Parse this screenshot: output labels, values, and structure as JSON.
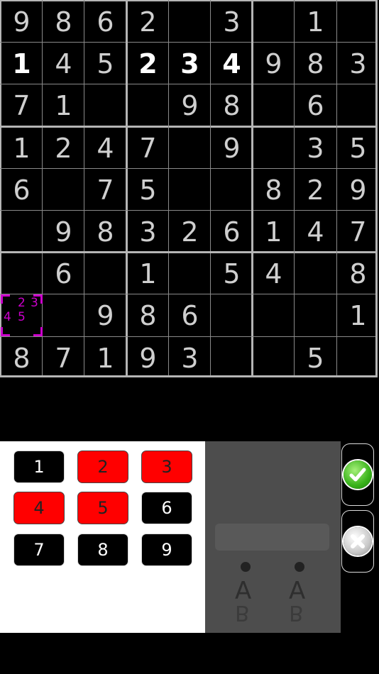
{
  "board": {
    "rows": [
      [
        "9",
        "8",
        "6",
        "2",
        "",
        "3",
        "",
        "1",
        ""
      ],
      [
        "1",
        "4",
        "5",
        "2",
        "3",
        "4",
        "9",
        "8",
        "3"
      ],
      [
        "7",
        "1",
        "",
        "",
        "9",
        "8",
        "",
        "6",
        ""
      ],
      [
        "1",
        "2",
        "4",
        "7",
        "",
        "9",
        "",
        "3",
        "5"
      ],
      [
        "6",
        "",
        "7",
        "5",
        "",
        "",
        "8",
        "2",
        "9"
      ],
      [
        "",
        "9",
        "8",
        "3",
        "2",
        "6",
        "1",
        "4",
        "7"
      ],
      [
        "",
        "6",
        "",
        "1",
        "",
        "5",
        "4",
        "",
        "8"
      ],
      [
        "",
        "",
        "9",
        "8",
        "6",
        "",
        "",
        "",
        "1"
      ],
      [
        "8",
        "7",
        "1",
        "9",
        "3",
        "",
        "",
        "5",
        ""
      ]
    ],
    "bright_cells": [
      [
        1,
        0
      ],
      [
        1,
        3
      ],
      [
        1,
        4
      ],
      [
        1,
        5
      ]
    ],
    "selected_cell": [
      7,
      0
    ],
    "selected_notes": [
      "2",
      "3",
      "4",
      "5"
    ],
    "note_color": "#cc00cc"
  },
  "keypad": {
    "keys": [
      {
        "label": "1",
        "active": false
      },
      {
        "label": "2",
        "active": true
      },
      {
        "label": "3",
        "active": true
      },
      {
        "label": "4",
        "active": true
      },
      {
        "label": "5",
        "active": true
      },
      {
        "label": "6",
        "active": false
      },
      {
        "label": "7",
        "active": false
      },
      {
        "label": "8",
        "active": false
      },
      {
        "label": "9",
        "active": false
      }
    ],
    "active_color": "#ff0000"
  },
  "mode_toggles": [
    {
      "top": "A",
      "bottom": "B"
    },
    {
      "top": "A",
      "bottom": "B"
    }
  ],
  "icons": {
    "confirm": "check-icon",
    "cancel": "close-icon"
  }
}
